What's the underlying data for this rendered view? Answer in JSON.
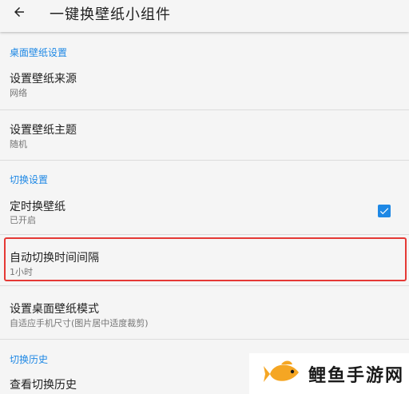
{
  "appbar": {
    "title": "一键换壁纸小组件",
    "back_icon": "arrow-left-icon"
  },
  "sections": [
    {
      "header": "桌面壁纸设置",
      "items": [
        {
          "title": "设置壁纸来源",
          "summary": "网络"
        },
        {
          "title": "设置壁纸主题",
          "summary": "随机"
        }
      ]
    },
    {
      "header": "切换设置",
      "items": [
        {
          "title": "定时换壁纸",
          "summary": "已开启",
          "checked": true
        },
        {
          "title": "自动切换时间间隔",
          "summary": "1小时",
          "highlighted": true
        },
        {
          "title": "设置桌面壁纸模式",
          "summary": "自适应手机尺寸(图片居中适度裁剪)"
        }
      ]
    },
    {
      "header": "切换历史",
      "items": [
        {
          "title": "查看切换历史",
          "summary": ""
        }
      ]
    }
  ],
  "watermark": {
    "text": "鲤鱼手游网",
    "logo_icon": "fish-logo-icon"
  },
  "colors": {
    "accent": "#1e88e5",
    "highlight_border": "#e53935",
    "background": "#f5f5f5",
    "summary_text": "#757575"
  }
}
